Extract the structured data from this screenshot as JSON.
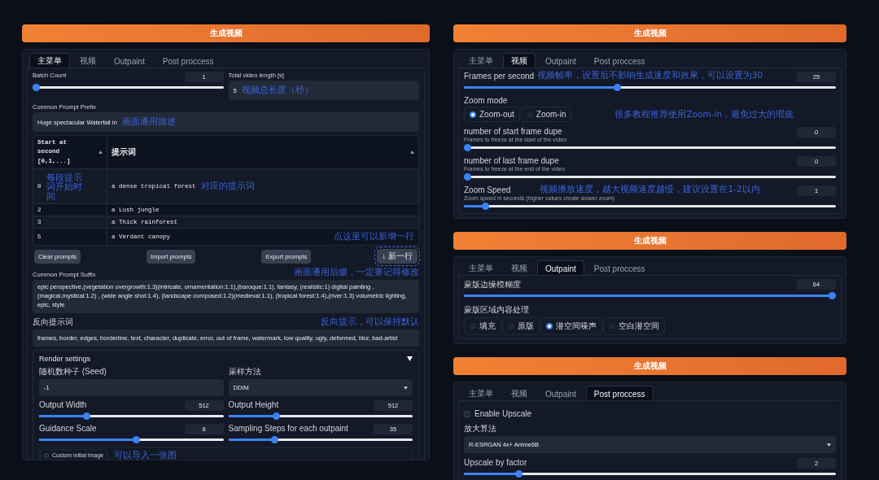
{
  "left": {
    "generate_button": "生成视频",
    "tabs": [
      {
        "label": "主菜单",
        "selected": true
      },
      {
        "label": "视频",
        "selected": false
      },
      {
        "label": "Outpaint",
        "selected": false
      },
      {
        "label": "Post proccess",
        "selected": false
      }
    ],
    "batch_count": {
      "kind": "slider",
      "label": "Batch Count",
      "value": "1",
      "level": 0
    },
    "video_length": {
      "kind": "field",
      "label": "Total video length [s]",
      "value": "5",
      "note": "视频总长度（秒）"
    },
    "prefix": {
      "kind": "field",
      "label": "Common Prompt Prefix",
      "value": "Huge spectacular Waterfall in",
      "note": "画面通用描述"
    },
    "prompt_table": {
      "columns": [
        "Start at second [0,1,...]",
        "提示词"
      ],
      "rows": [
        {
          "start": "0",
          "prompt": "a dense tropical forest",
          "start_note": "每段提示词开始时间",
          "prompt_note": "对应的提示词"
        },
        {
          "start": "2",
          "prompt": "a Lush jungle"
        },
        {
          "start": "3",
          "prompt": "a Thick rainforest"
        },
        {
          "start": "5",
          "prompt": "a Verdant canopy"
        }
      ]
    },
    "table_buttons": [
      "Clear prompts",
      "Import prompts",
      "Export prompts"
    ],
    "add_row": {
      "label": "↓ 新一行",
      "note": "点这里可以新增一行"
    },
    "suffix": {
      "label": "Common Prompt Suffix",
      "value": "epic perspective,(vegetation overgrowth:1.3)(intricate, ornamentation:1.1),(baroque:1.1), fantasy, (realistic:1) digital painting , (magical,mystical:1.2) , (wide angle shot:1.4), (landscape composed:1.2)(medieval:1.1), (tropical forest:1.4),(river:1.3) volumetric lighting, epic, style",
      "note": "画面通用后缀，一定要记得修改"
    },
    "negative": {
      "label": "反向提示词",
      "value": "frames, border, edges, borderline, text, character, duplicate, error, out of frame, watermark, low quality, ugly, deformed, blur, bad-artist",
      "note": "反向提示，可以保持默认"
    },
    "render_settings": {
      "title": "Render settings",
      "expanded": true,
      "controls": [
        {
          "kind": "field",
          "label": "随机数种子 (Seed)",
          "value": "-1"
        },
        {
          "kind": "dropdown",
          "label": "采样方法",
          "value": "DDIM"
        },
        {
          "kind": "slider",
          "label": "Output Width",
          "value": "512",
          "level": 0.25
        },
        {
          "kind": "slider",
          "label": "Output Height",
          "value": "512",
          "level": 0.25
        },
        {
          "kind": "slider",
          "label": "Guidance Scale",
          "value": "8",
          "level": 0.53
        },
        {
          "kind": "slider",
          "label": "Sampling Steps for each outpaint",
          "value": "35",
          "level": 0.24
        }
      ],
      "custom_image": {
        "label": "Custom initial image",
        "checked": false,
        "note": "可以导入一张图"
      }
    }
  },
  "right": [
    {
      "generate_button": "生成视频",
      "tabs": [
        {
          "label": "主菜单",
          "selected": false
        },
        {
          "label": "视频",
          "selected": true
        },
        {
          "label": "Outpaint",
          "selected": false
        },
        {
          "label": "Post proccess",
          "selected": false
        }
      ],
      "controls": [
        {
          "kind": "slider",
          "label": "Frames per second",
          "value": "25",
          "level": 0.41,
          "note": "视频帧率，设置后不影响生成速度和效果，可以设置为30"
        },
        {
          "kind": "radio",
          "label": "Zoom mode",
          "options": [
            {
              "label": "Zoom-out",
              "selected": true
            },
            {
              "label": "Zoom-in",
              "selected": false
            }
          ],
          "note": "很多教程推荐使用Zoom-in，避免过大的瑕疵"
        },
        {
          "kind": "slider",
          "label": "number of start frame dupe",
          "sublabel": "Frames to freeze at the start of the video",
          "value": "0",
          "level": 0
        },
        {
          "kind": "slider",
          "label": "number of last frame dupe",
          "sublabel": "Frames to freeze at the end of the video",
          "value": "0",
          "level": 0
        },
        {
          "kind": "slider",
          "label": "Zoom Speed",
          "sublabel": "Zoom speed in seconds (higher values create slower zoom)",
          "value": "1",
          "level": 0.05,
          "note": "视频播放速度，越大视频速度越慢，建议设置在1-2以内"
        }
      ]
    },
    {
      "generate_button": "生成视频",
      "tabs": [
        {
          "label": "主菜单",
          "selected": false
        },
        {
          "label": "视频",
          "selected": false
        },
        {
          "label": "Outpaint",
          "selected": true
        },
        {
          "label": "Post proccess",
          "selected": false
        }
      ],
      "controls": [
        {
          "kind": "slider",
          "label": "蒙版边缘模糊度",
          "value": "64",
          "level": 1
        },
        {
          "kind": "radio",
          "label": "蒙版区域内容处理",
          "options": [
            {
              "label": "填充",
              "selected": false
            },
            {
              "label": "原版",
              "selected": false
            },
            {
              "label": "潜空间噪声",
              "selected": true
            },
            {
              "label": "空白潜空间",
              "selected": false
            }
          ]
        }
      ]
    },
    {
      "generate_button": "生成视频",
      "tabs": [
        {
          "label": "主菜单",
          "selected": false
        },
        {
          "label": "视频",
          "selected": false
        },
        {
          "label": "Outpaint",
          "selected": false
        },
        {
          "label": "Post proccess",
          "selected": true
        }
      ],
      "controls": [
        {
          "kind": "checkbox",
          "label": "Enable Upscale",
          "checked": false
        },
        {
          "kind": "dropdown",
          "label": "放大算法",
          "value": "R-ESRGAN 4x+ Anime6B"
        },
        {
          "kind": "slider",
          "label": "Upscale by factor",
          "value": "2",
          "level": 0.14
        }
      ]
    }
  ]
}
